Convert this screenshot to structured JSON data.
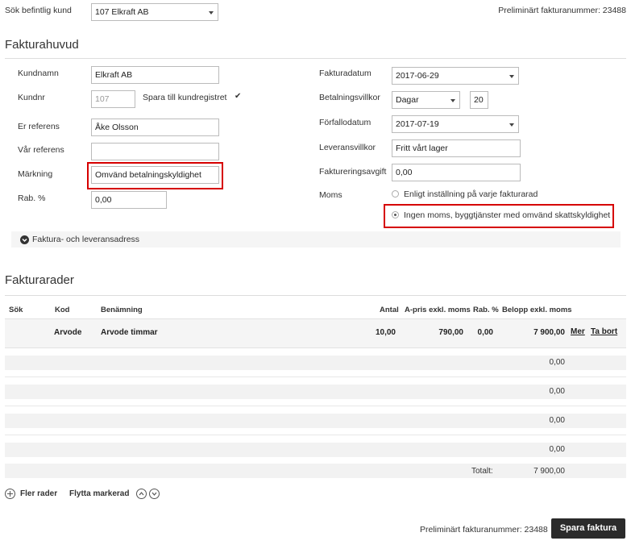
{
  "top": {
    "search_label": "Sök befintlig kund",
    "customer_select": "107 Elkraft AB",
    "prelim_number": "Preliminärt fakturanummer: 23488"
  },
  "header_section": {
    "title": "Fakturahuvud",
    "left": {
      "customer_name_label": "Kundnamn",
      "customer_name_value": "Elkraft AB",
      "customer_no_label": "Kundnr",
      "customer_no_value": "107",
      "save_to_register_label": "Spara till kundregistret",
      "your_ref_label": "Er referens",
      "your_ref_value": "Åke Olsson",
      "our_ref_label": "Vår referens",
      "our_ref_value": "",
      "marking_label": "Märkning",
      "marking_value": "Omvänd betalningskyldighet",
      "discount_label": "Rab. %",
      "discount_value": "0,00"
    },
    "right": {
      "invoice_date_label": "Fakturadatum",
      "invoice_date_value": "2017-06-29",
      "payment_terms_label": "Betalningsvillkor",
      "payment_terms_value": "Dagar",
      "payment_days_value": "20",
      "due_date_label": "Förfallodatum",
      "due_date_value": "2017-07-19",
      "delivery_terms_label": "Leveransvillkor",
      "delivery_terms_value": "Fritt vårt lager",
      "invoicing_fee_label": "Faktureringsavgift",
      "invoicing_fee_value": "0,00",
      "vat_label": "Moms",
      "vat_option_1": "Enligt inställning på varje fakturarad",
      "vat_option_2": "Ingen moms, byggtjänster med omvänd skattskyldighet"
    },
    "address_toggle": "Faktura- och leveransadress"
  },
  "rows_section": {
    "title": "Fakturarader",
    "columns": {
      "search": "Sök",
      "code": "Kod",
      "name": "Benämning",
      "qty": "Antal",
      "price": "A-pris exkl. moms",
      "discount": "Rab. %",
      "amount": "Belopp exkl. moms"
    },
    "first_row": {
      "code": "Arvode",
      "name": "Arvode timmar",
      "qty": "10,00",
      "price": "790,00",
      "discount": "0,00",
      "amount": "7 900,00",
      "more": "Mer",
      "delete": "Ta bort"
    },
    "empty_amounts": [
      "0,00",
      "0,00",
      "0,00",
      "0,00"
    ],
    "total_label": "Totalt:",
    "total_value": "7 900,00",
    "more_rows": "Fler rader",
    "move_selected": "Flytta markerad"
  },
  "footer": {
    "prelim_number": "Preliminärt fakturanummer: 23488",
    "save_button": "Spara faktura"
  },
  "colors": {
    "highlight": "#d60000",
    "button_bg": "#2b2b2b",
    "row_bg": "#f2f2f2"
  }
}
